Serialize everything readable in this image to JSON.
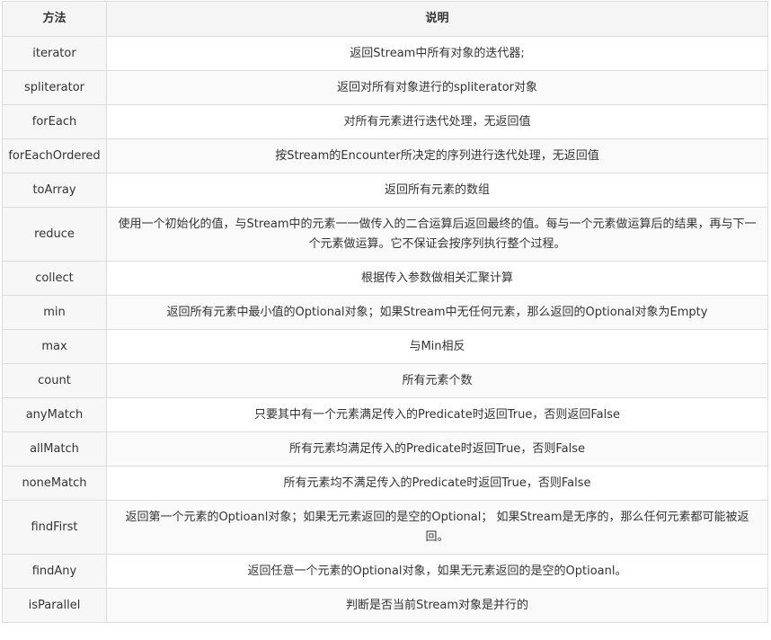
{
  "table": {
    "headers": {
      "method": "方法",
      "description": "说明"
    },
    "rows": [
      {
        "method": "iterator",
        "description": "返回Stream中所有对象的迭代器;"
      },
      {
        "method": "spliterator",
        "description": "返回对所有对象进行的spliterator对象"
      },
      {
        "method": "forEach",
        "description": "对所有元素进行迭代处理，无返回值"
      },
      {
        "method": "forEachOrdered",
        "description": "按Stream的Encounter所决定的序列进行迭代处理，无返回值"
      },
      {
        "method": "toArray",
        "description": "返回所有元素的数组"
      },
      {
        "method": "reduce",
        "description": "使用一个初始化的值，与Stream中的元素一一做传入的二合运算后返回最终的值。每与一个元素做运算后的结果，再与下一个元素做运算。它不保证会按序列执行整个过程。"
      },
      {
        "method": "collect",
        "description": "根据传入参数做相关汇聚计算"
      },
      {
        "method": "min",
        "description": "返回所有元素中最小值的Optional对象；如果Stream中无任何元素，那么返回的Optional对象为Empty"
      },
      {
        "method": "max",
        "description": "与Min相反"
      },
      {
        "method": "count",
        "description": "所有元素个数"
      },
      {
        "method": "anyMatch",
        "description": "只要其中有一个元素满足传入的Predicate时返回True，否则返回False"
      },
      {
        "method": "allMatch",
        "description": "所有元素均满足传入的Predicate时返回True，否则False"
      },
      {
        "method": "noneMatch",
        "description": "所有元素均不满足传入的Predicate时返回True，否则False"
      },
      {
        "method": "findFirst",
        "description": "返回第一个元素的Optioanl对象；如果无元素返回的是空的Optional； 如果Stream是无序的，那么任何元素都可能被返回。"
      },
      {
        "method": "findAny",
        "description": "返回任意一个元素的Optional对象，如果无元素返回的是空的Optioanl。"
      },
      {
        "method": "isParallel",
        "description": "判断是否当前Stream对象是并行的"
      }
    ]
  }
}
